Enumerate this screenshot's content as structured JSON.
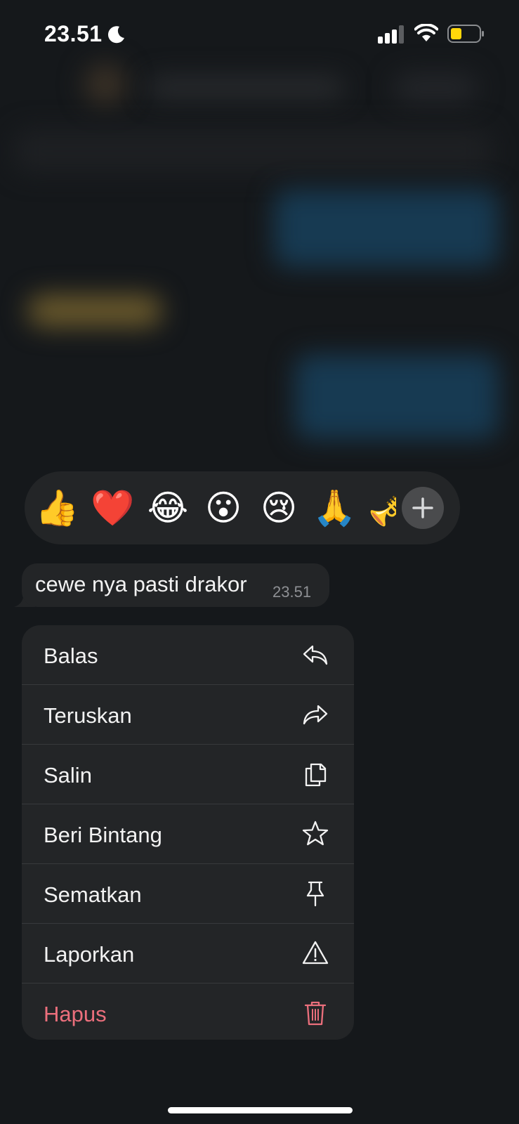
{
  "status_bar": {
    "time": "23.51",
    "focus_icon": "moon-icon",
    "signal_icon": "cellular-signal-icon",
    "wifi_icon": "wifi-icon",
    "battery_icon": "battery-low-icon",
    "battery_color": "#ffd60a"
  },
  "reactions": {
    "items": [
      "👍",
      "❤️",
      "😂",
      "😮",
      "😢",
      "🙏",
      "🎺"
    ],
    "more_icon": "plus-icon"
  },
  "message": {
    "text": "cewe nya pasti drakor",
    "time": "23.51"
  },
  "menu": {
    "items": [
      {
        "label": "Balas",
        "icon": "reply-icon"
      },
      {
        "label": "Teruskan",
        "icon": "forward-icon"
      },
      {
        "label": "Salin",
        "icon": "copy-icon"
      },
      {
        "label": "Beri Bintang",
        "icon": "star-icon"
      },
      {
        "label": "Sematkan",
        "icon": "pin-icon"
      },
      {
        "label": "Laporkan",
        "icon": "warning-icon"
      },
      {
        "label": "Hapus",
        "icon": "trash-icon",
        "color": "#eb6f7c"
      }
    ]
  }
}
